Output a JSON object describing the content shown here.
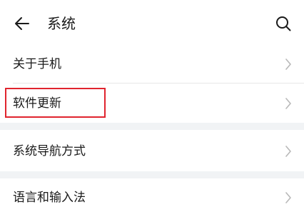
{
  "header": {
    "title": "系统",
    "back_icon": "back-arrow-icon",
    "search_icon": "search-icon"
  },
  "settings": {
    "groups": [
      {
        "items": [
          {
            "label": "关于手机"
          },
          {
            "label": "软件更新"
          }
        ]
      },
      {
        "items": [
          {
            "label": "系统导航方式"
          }
        ]
      },
      {
        "items": [
          {
            "label": "语言和输入法"
          }
        ]
      }
    ]
  },
  "highlight": {
    "target": "软件更新",
    "color": "#e0242e"
  },
  "colors": {
    "background": "#ffffff",
    "group_gap": "#f1f3f5",
    "divider": "#e8e8e8",
    "chevron": "#b8b8b8"
  }
}
